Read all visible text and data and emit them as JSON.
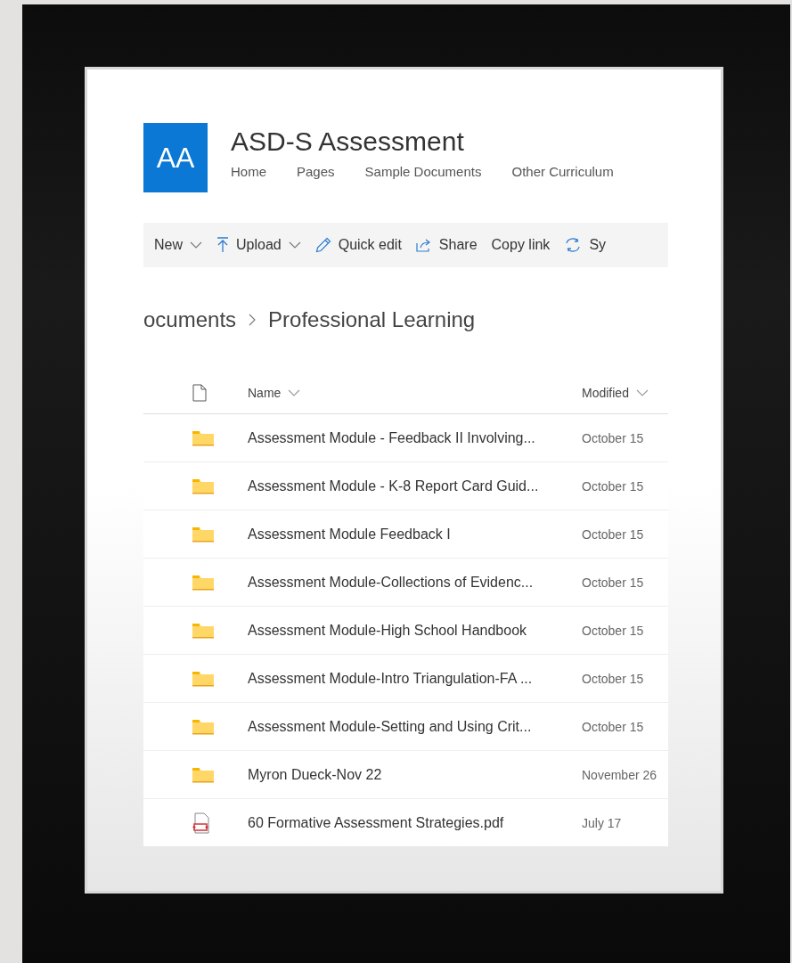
{
  "site": {
    "logo": "AA",
    "title": "ASD-S Assessment"
  },
  "nav": [
    {
      "label": "Home"
    },
    {
      "label": "Pages"
    },
    {
      "label": "Sample Documents"
    },
    {
      "label": "Other Curriculum"
    }
  ],
  "toolbar": [
    {
      "kind": "new",
      "label": "New",
      "dropdown": true
    },
    {
      "kind": "upload",
      "label": "Upload",
      "dropdown": true
    },
    {
      "kind": "edit",
      "label": "Quick edit",
      "dropdown": false
    },
    {
      "kind": "share",
      "label": "Share",
      "dropdown": false
    },
    {
      "kind": "link",
      "label": "Copy link",
      "dropdown": false
    },
    {
      "kind": "sync",
      "label": "Sy",
      "dropdown": false
    }
  ],
  "breadcrumb": [
    "ocuments",
    "Professional Learning"
  ],
  "table": {
    "columns": [
      "Name",
      "Modified"
    ],
    "rows": [
      {
        "kind": "folder",
        "name": "Assessment Module - Feedback II Involving...",
        "modified": "October 15"
      },
      {
        "kind": "folder",
        "name": "Assessment Module - K-8 Report Card Guid...",
        "modified": "October 15"
      },
      {
        "kind": "folder",
        "name": "Assessment Module Feedback I",
        "modified": "October 15"
      },
      {
        "kind": "folder",
        "name": "Assessment Module-Collections of Evidenc...",
        "modified": "October 15"
      },
      {
        "kind": "folder",
        "name": "Assessment Module-High School Handbook",
        "modified": "October 15"
      },
      {
        "kind": "folder",
        "name": "Assessment Module-Intro Triangulation-FA ...",
        "modified": "October 15"
      },
      {
        "kind": "folder",
        "name": "Assessment Module-Setting and Using Crit...",
        "modified": "October 15"
      },
      {
        "kind": "folder",
        "name": "Myron Dueck-Nov 22",
        "modified": "November 26"
      },
      {
        "kind": "pdf",
        "name": "60 Formative Assessment Strategies.pdf",
        "modified": "July 17"
      }
    ]
  }
}
